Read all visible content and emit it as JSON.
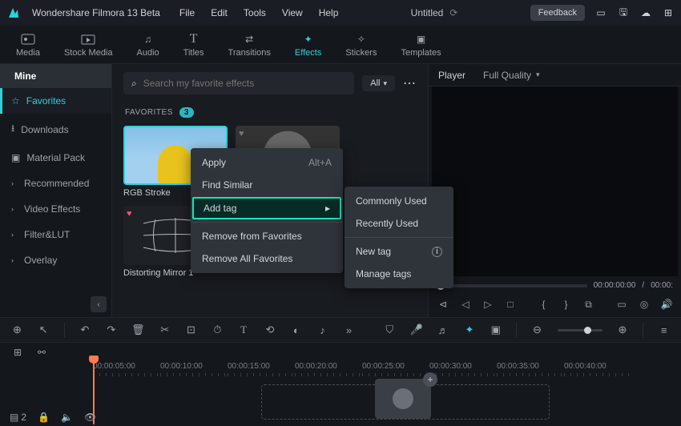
{
  "titlebar": {
    "app_name": "Wondershare Filmora 13 Beta",
    "menus": [
      "File",
      "Edit",
      "Tools",
      "View",
      "Help"
    ],
    "doc_title": "Untitled",
    "feedback": "Feedback"
  },
  "tabs": [
    {
      "label": "Media"
    },
    {
      "label": "Stock Media"
    },
    {
      "label": "Audio"
    },
    {
      "label": "Titles"
    },
    {
      "label": "Transitions"
    },
    {
      "label": "Effects"
    },
    {
      "label": "Stickers"
    },
    {
      "label": "Templates"
    }
  ],
  "sidebar": {
    "mine": "Mine",
    "items": [
      {
        "label": "Favorites",
        "icon": "star"
      },
      {
        "label": "Downloads",
        "icon": "download"
      },
      {
        "label": "Material Pack",
        "icon": "box"
      },
      {
        "label": "Recommended",
        "chev": true
      },
      {
        "label": "Video Effects",
        "chev": true
      },
      {
        "label": "Filter&LUT",
        "chev": true
      },
      {
        "label": "Overlay",
        "chev": true
      }
    ]
  },
  "content": {
    "search_placeholder": "Search my favorite effects",
    "all_label": "All",
    "fav_label": "FAVORITES",
    "fav_count": "3",
    "cards": [
      {
        "label": "RGB Stroke"
      },
      {
        "label": ""
      },
      {
        "label": "Distorting Mirror 1"
      }
    ]
  },
  "ctxmenu": {
    "apply": "Apply",
    "apply_shortcut": "Alt+A",
    "find_similar": "Find Similar",
    "add_tag": "Add tag",
    "remove_fav": "Remove from Favorites",
    "remove_all": "Remove All Favorites"
  },
  "submenu": {
    "commonly": "Commonly Used",
    "recently": "Recently Used",
    "new_tag": "New tag",
    "manage": "Manage tags"
  },
  "player": {
    "tab": "Player",
    "quality": "Full Quality",
    "time_cur": "00:00:00:00",
    "time_total": "00:00:"
  },
  "timeline": {
    "ticks": [
      "00:00:05:00",
      "00:00:10:00",
      "00:00:15:00",
      "00:00:20:00",
      "00:00:25:00",
      "00:00:30:00",
      "00:00:35:00",
      "00:00:40:00"
    ],
    "track_count": "2"
  }
}
